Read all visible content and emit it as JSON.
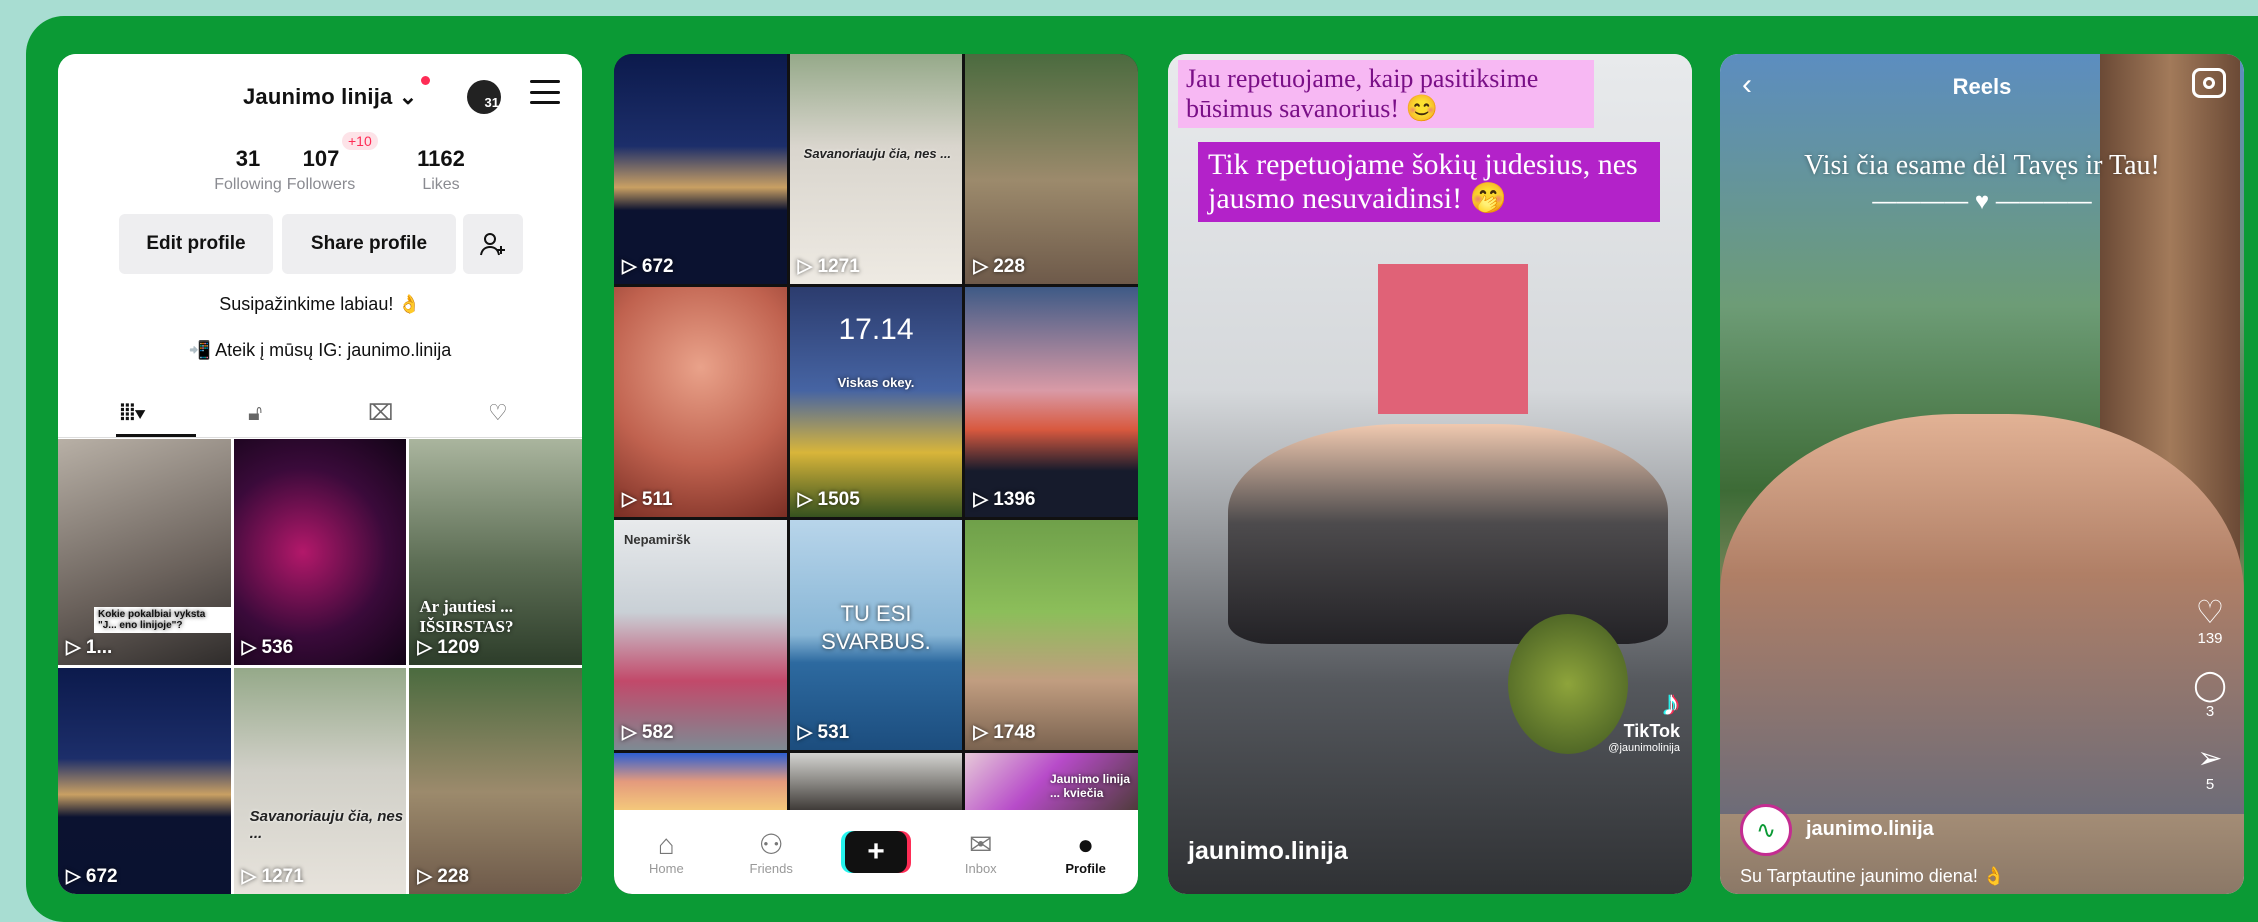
{
  "colors": {
    "frame_green": "#0b9a35",
    "outer_teal": "#a8ddd2",
    "tiktok_red": "#fe2c55",
    "tiktok_cyan": "#25f4ee"
  },
  "profile": {
    "username": "Jaunimo linija",
    "notif_count": "31",
    "stats": [
      {
        "value": "31",
        "label": "Following"
      },
      {
        "value": "107",
        "label": "Followers",
        "badge": "+10"
      },
      {
        "value": "1162",
        "label": "Likes"
      }
    ],
    "buttons": {
      "edit": "Edit profile",
      "share": "Share profile"
    },
    "bio_line1": "Susipažinkime labiau! 👌",
    "bio_line2": "📲 Ateik į mūsų IG: jaunimo.linija",
    "videos": [
      {
        "views": "1...",
        "caption": "Kokie pokalbiai vyksta \"J... eno linijoje\"?"
      },
      {
        "views": "536"
      },
      {
        "views": "1209",
        "caption": "Ar jautiesi ... IŠSIRSTAS?"
      },
      {
        "views": "672"
      },
      {
        "views": "1271",
        "caption": "Savanoriauju čia, nes ..."
      },
      {
        "views": "228"
      }
    ]
  },
  "feed": {
    "videos": [
      {
        "views": "672"
      },
      {
        "views": "1271",
        "caption": "Savanoriauju čia, nes ..."
      },
      {
        "views": "228"
      },
      {
        "views": "511"
      },
      {
        "views": "1505",
        "time": "17.14",
        "caption": "Viskas okey."
      },
      {
        "views": "1396"
      },
      {
        "views": "582",
        "caption": "Nepamiršk"
      },
      {
        "views": "531",
        "caption": "TU ESI SVARBUS."
      },
      {
        "views": "1748"
      },
      {
        "views": ""
      },
      {
        "views": ""
      },
      {
        "views": "",
        "caption": "Jaunimo linija ... kviečia"
      }
    ],
    "nav": [
      {
        "label": "Home",
        "icon": "home-icon"
      },
      {
        "label": "Friends",
        "icon": "friends-icon"
      },
      {
        "label": "",
        "icon": "plus-icon"
      },
      {
        "label": "Inbox",
        "icon": "inbox-icon"
      },
      {
        "label": "Profile",
        "icon": "profile-icon"
      }
    ]
  },
  "tiktok_video": {
    "caption1": "Jau repetuojame, kaip pasitiksime būsimus savanorius! 😊",
    "caption2": "Tik repetuojame šokių judesius, nes jausmo nesuvaidinsi! 🤭",
    "watermark": "TikTok",
    "watermark_handle": "@jaunimolinija",
    "account": "jaunimo.linija"
  },
  "reels": {
    "title": "Reels",
    "overlay_text": "Visi čia esame dėl Tavęs ir Tau!",
    "likes": "139",
    "comments": "3",
    "shares": "5",
    "account": "jaunimo.linija",
    "caption": "Su Tarptautine jaunimo diena! 👌"
  }
}
